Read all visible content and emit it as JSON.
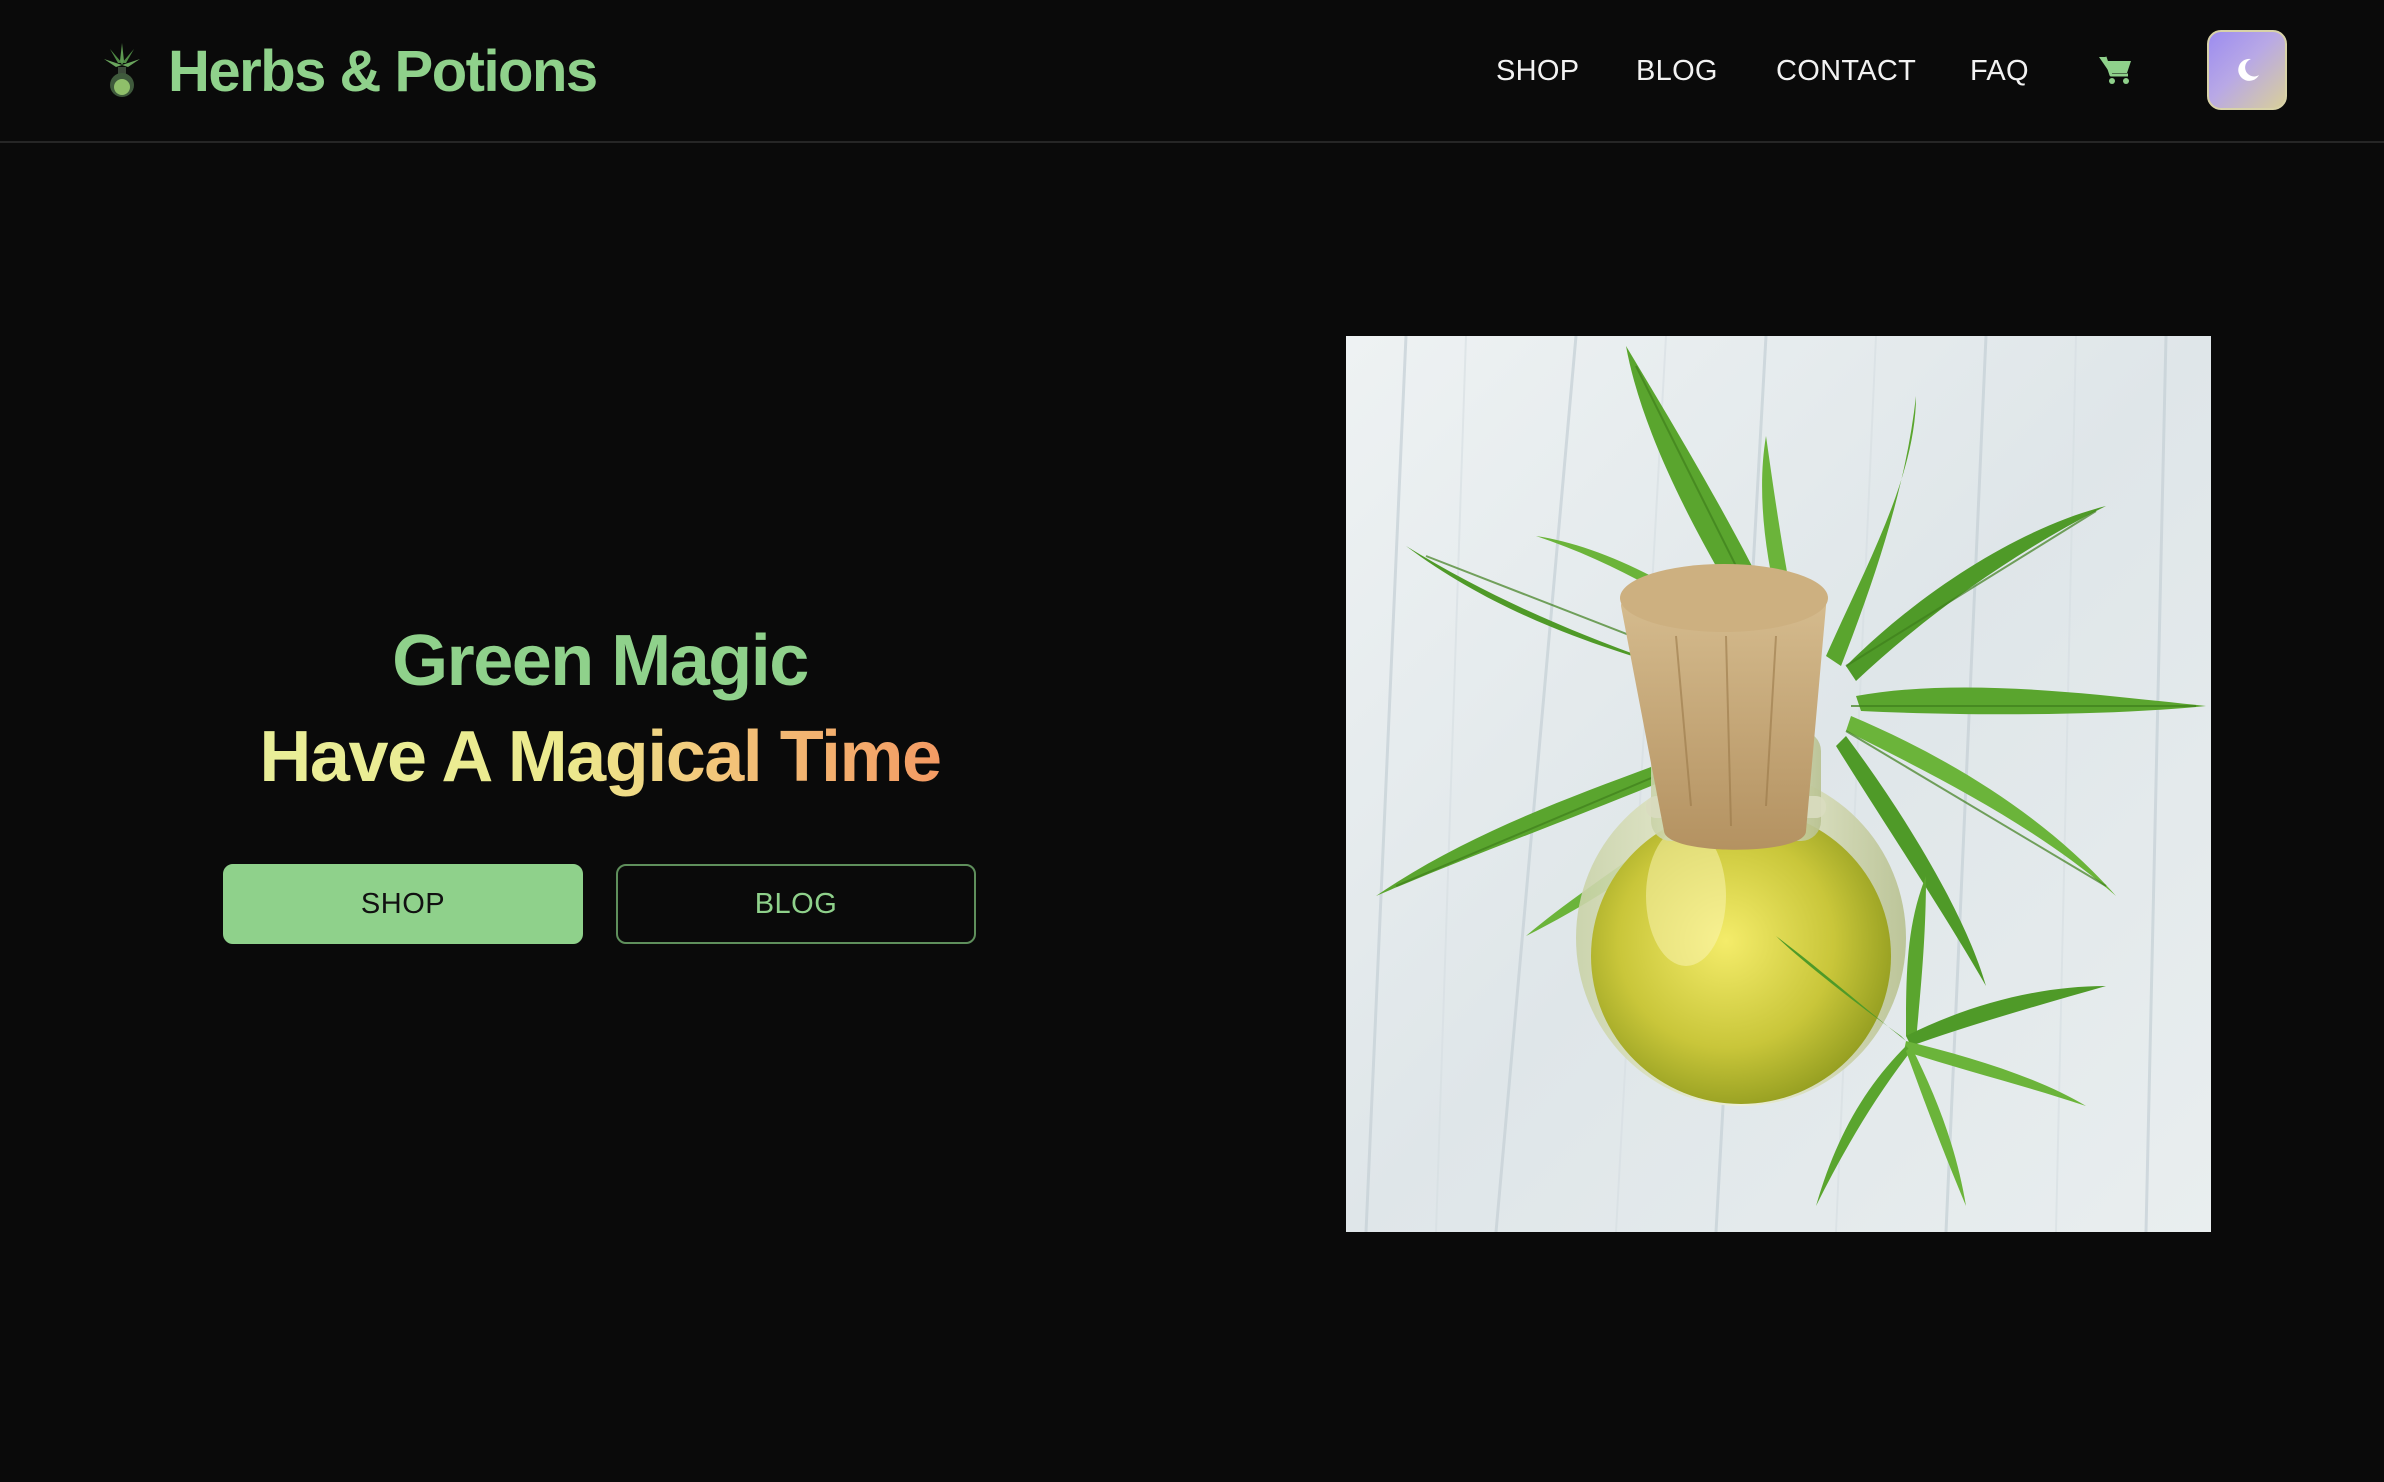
{
  "header": {
    "brand_name": "Herbs & Potions",
    "logo_icon": "cannabis-potion-logo-icon",
    "nav": {
      "shop": "SHOP",
      "blog": "BLOG",
      "contact": "CONTACT",
      "faq": "FAQ"
    },
    "cart_icon": "shopping-cart-icon",
    "theme_toggle_icon": "moon-icon"
  },
  "hero": {
    "title_line_1": "Green Magic",
    "title_line_2": "Have A Magical Time",
    "shop_button": "SHOP",
    "blog_button": "BLOG",
    "image_subject": "cannabis-oil-bottle-image"
  },
  "colors": {
    "background": "#0a0a0a",
    "accent_green": "#8fd18b",
    "gradient_yellow": "#e9ee98",
    "gradient_orange": "#f39a63",
    "toggle_purple": "#9c8cf0"
  }
}
